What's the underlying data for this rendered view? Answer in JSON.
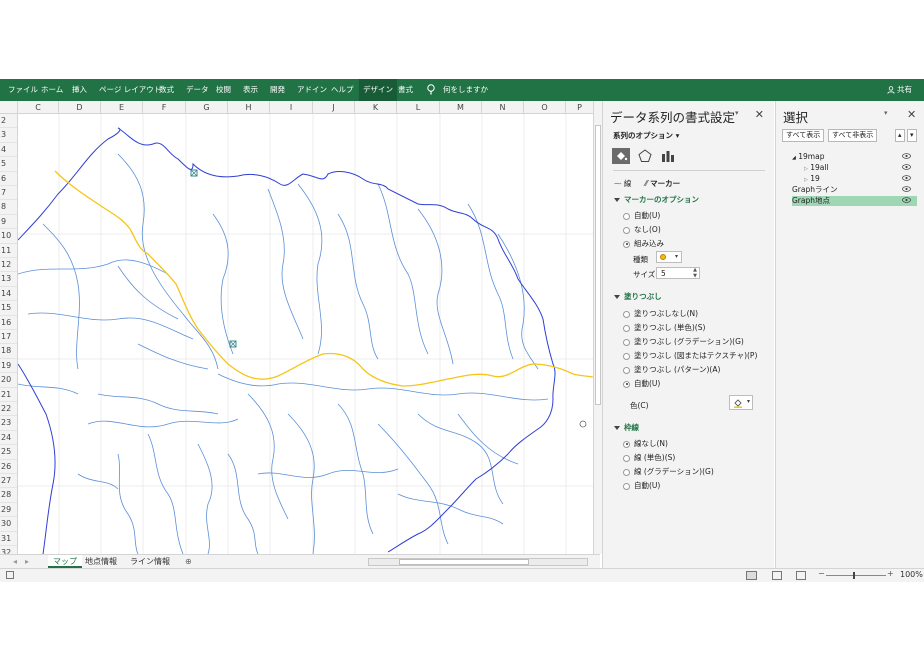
{
  "ribbon": {
    "tabs": [
      "ファイル",
      "ホーム",
      "挿入",
      "ページ レイアウト",
      "数式",
      "データ",
      "校閲",
      "表示",
      "開発",
      "アドイン",
      "ヘルプ",
      "デザイン",
      "書式"
    ],
    "selected_tab": "デザイン",
    "tell_me": "何をしますか",
    "share": "共有",
    "color": "#217346"
  },
  "columns": [
    "C",
    "D",
    "E",
    "F",
    "G",
    "H",
    "I",
    "J",
    "K",
    "L",
    "M",
    "N",
    "O",
    "P"
  ],
  "rows": [
    "2",
    "3",
    "4",
    "5",
    "6",
    "7",
    "8",
    "9",
    "10",
    "11",
    "12",
    "13",
    "14",
    "15",
    "16",
    "17",
    "18",
    "19",
    "20",
    "21",
    "22",
    "23",
    "24",
    "25",
    "26",
    "27",
    "28",
    "29",
    "30",
    "31",
    "32"
  ],
  "map": {
    "boundary_color": "#2f3fd6",
    "river_color": "#5b8fd8",
    "route_color": "#f5c518",
    "marker_color": "#3a8a88"
  },
  "sheets": {
    "tabs": [
      "マップ",
      "地点情報",
      "ライン情報"
    ],
    "active": "マップ"
  },
  "status": {
    "zoom": "100%"
  },
  "format_pane": {
    "title": "データ系列の書式設定",
    "series_options": "系列のオプション",
    "subtabs": {
      "line": "線",
      "marker": "マーカー"
    },
    "marker_options": {
      "title": "マーカーのオプション",
      "options": [
        "自動(U)",
        "なし(O)",
        "組み込み"
      ],
      "selected": 2,
      "type_label": "種類",
      "size_label": "サイズ",
      "size_value": "5"
    },
    "fill": {
      "title": "塗りつぶし",
      "options": [
        "塗りつぶしなし(N)",
        "塗りつぶし (単色)(S)",
        "塗りつぶし (グラデーション)(G)",
        "塗りつぶし (図またはテクスチャ)(P)",
        "塗りつぶし (パターン)(A)",
        "自動(U)"
      ],
      "selected": 5,
      "color_label": "色(C)"
    },
    "border": {
      "title": "枠線",
      "options": [
        "線なし(N)",
        "線 (単色)(S)",
        "線 (グラデーション)(G)",
        "自動(U)"
      ],
      "selected": 0
    }
  },
  "selection_pane": {
    "title": "選択",
    "show_all": "すべて表示",
    "hide_all": "すべて非表示",
    "items": [
      "19map",
      "19all",
      "19",
      "Graphライン",
      "Graph地点"
    ],
    "active": "Graph地点"
  }
}
